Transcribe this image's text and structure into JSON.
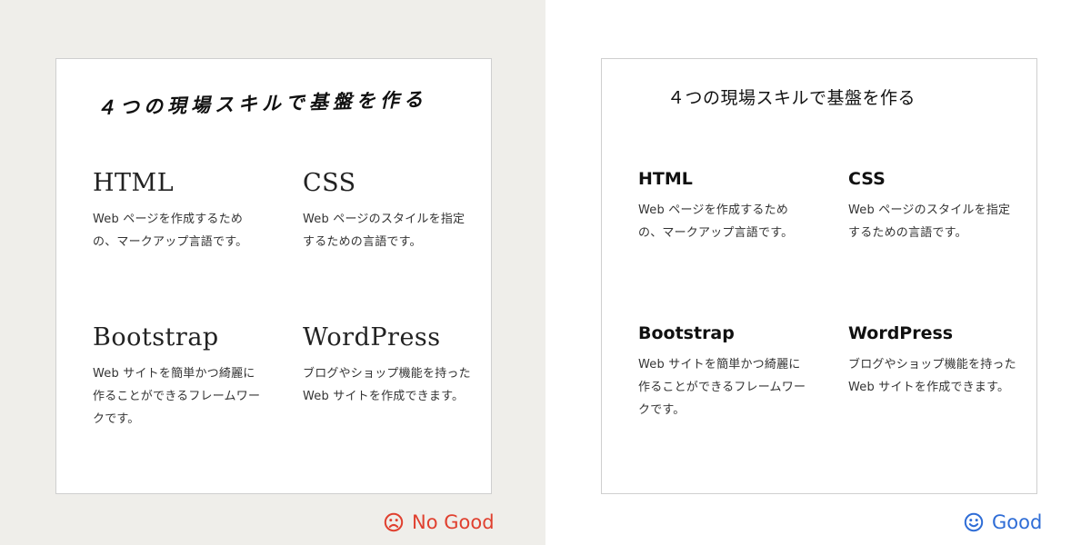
{
  "panels": {
    "bad": {
      "title": "４つの現場スキルで基盤を作る",
      "items": [
        {
          "heading": "HTML",
          "desc": "Web ページを作成するための、マークアップ言語です。"
        },
        {
          "heading": "CSS",
          "desc": "Web ページのスタイルを指定するための言語です。"
        },
        {
          "heading": "Bootstrap",
          "desc": "Web サイトを簡単かつ綺麗に作ることができるフレームワークです。"
        },
        {
          "heading": "WordPress",
          "desc": "ブログやショップ機能を持った Web サイトを作成できます。"
        }
      ],
      "verdict_label": "No Good",
      "verdict_icon": "frown-face-icon",
      "verdict_color": "#e0402f",
      "background": "#efeeea"
    },
    "good": {
      "title": "４つの現場スキルで基盤を作る",
      "items": [
        {
          "heading": "HTML",
          "desc": "Web ページを作成するための、マークアップ言語です。"
        },
        {
          "heading": "CSS",
          "desc": "Web ページのスタイルを指定するための言語です。"
        },
        {
          "heading": "Bootstrap",
          "desc": "Web サイトを簡単かつ綺麗に作ることができるフレームワークです。"
        },
        {
          "heading": "WordPress",
          "desc": "ブログやショップ機能を持った Web サイトを作成できます。"
        }
      ],
      "verdict_label": "Good",
      "verdict_icon": "smile-face-icon",
      "verdict_color": "#2f6dd6",
      "background": "#ffffff"
    }
  }
}
